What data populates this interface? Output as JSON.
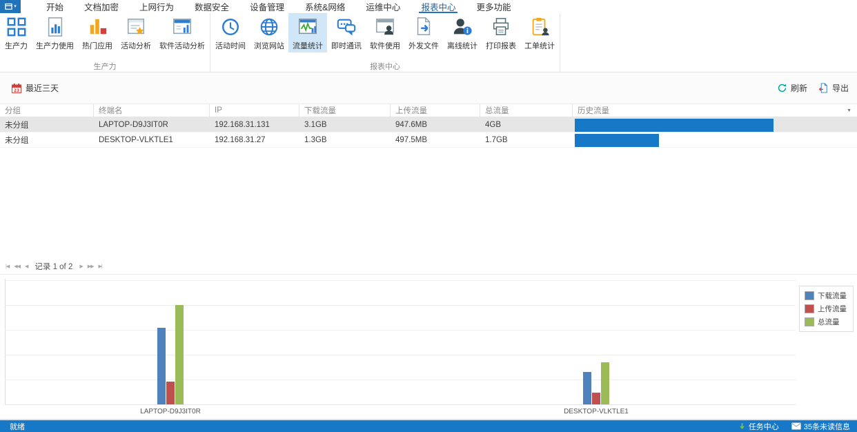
{
  "window": {
    "app_button_caret": "▾"
  },
  "menu": {
    "tabs": [
      {
        "label": "开始"
      },
      {
        "label": "文档加密"
      },
      {
        "label": "上网行为"
      },
      {
        "label": "数据安全"
      },
      {
        "label": "设备管理"
      },
      {
        "label": "系统&网络"
      },
      {
        "label": "运维中心"
      },
      {
        "label": "报表中心"
      },
      {
        "label": "更多功能"
      }
    ],
    "active_tab": "报表中心"
  },
  "ribbon": {
    "groups": [
      {
        "label": "生产力",
        "buttons": [
          {
            "label": "生产力"
          },
          {
            "label": "生产力使用"
          },
          {
            "label": "热门应用"
          },
          {
            "label": "活动分析"
          },
          {
            "label": "软件活动分析"
          }
        ]
      },
      {
        "label": "报表中心",
        "buttons": [
          {
            "label": "活动时间"
          },
          {
            "label": "浏览网站"
          },
          {
            "label": "流量统计"
          },
          {
            "label": "即时通讯"
          },
          {
            "label": "软件使用"
          },
          {
            "label": "外发文件"
          },
          {
            "label": "离线统计"
          },
          {
            "label": "打印报表"
          },
          {
            "label": "工单统计"
          }
        ]
      }
    ],
    "selected_button": "流量统计"
  },
  "toolbar": {
    "date_range": "最近三天",
    "refresh": "刷新",
    "export": "导出"
  },
  "table": {
    "columns": [
      "分组",
      "终端名",
      "IP",
      "下载流量",
      "上传流量",
      "总流量",
      "历史流量"
    ],
    "column_chooser_glyph": "▼",
    "rows": [
      {
        "group": "未分组",
        "terminal": "LAPTOP-D9J3IT0R",
        "ip": "192.168.31.131",
        "download": "3.1GB",
        "upload": "947.6MB",
        "total": "4GB",
        "history_gb": 4.0
      },
      {
        "group": "未分组",
        "terminal": "DESKTOP-VLKTLE1",
        "ip": "192.168.31.27",
        "download": "1.3GB",
        "upload": "497.5MB",
        "total": "1.7GB",
        "history_gb": 1.7
      }
    ],
    "selected_row_index": 0
  },
  "pagination": {
    "first": "|◀",
    "prev_fast": "◀◀",
    "prev": "◀",
    "label": "记录 1 of 2",
    "next": "▶",
    "next_fast": "▶▶",
    "last": "▶|"
  },
  "chart_data": {
    "type": "bar",
    "title": "",
    "xlabel": "",
    "ylabel": "",
    "unit": "GB",
    "categories": [
      "LAPTOP-D9J3IT0R",
      "DESKTOP-VLKTLE1"
    ],
    "series": [
      {
        "name": "下载流量",
        "color": "#4f81bd",
        "values_gb": [
          3.1,
          1.3
        ]
      },
      {
        "name": "上传流量",
        "color": "#c0504d",
        "values_gb": [
          0.925,
          0.486
        ]
      },
      {
        "name": "总流量",
        "color": "#9bbb59",
        "values_gb": [
          4.0,
          1.7
        ]
      }
    ],
    "ylim_gb": [
      0,
      5.2
    ],
    "gridline_step_gb": 1,
    "grid": true,
    "legend_position": "top-right"
  },
  "statusbar": {
    "ready": "就绪",
    "task_center": "任务中心",
    "unread": "35条未读信息"
  },
  "colors": {
    "accent": "#2272b9",
    "ribbon_selected_bg": "#cfe7f8",
    "statusbar_bg": "#1878c8",
    "history_bar": "#1878c8",
    "selected_row_bg": "#e6e6e6",
    "refresh_icon": "#00a6a0",
    "calendar_icon": "#d43f3a",
    "task_arrow": "#7ac143"
  }
}
